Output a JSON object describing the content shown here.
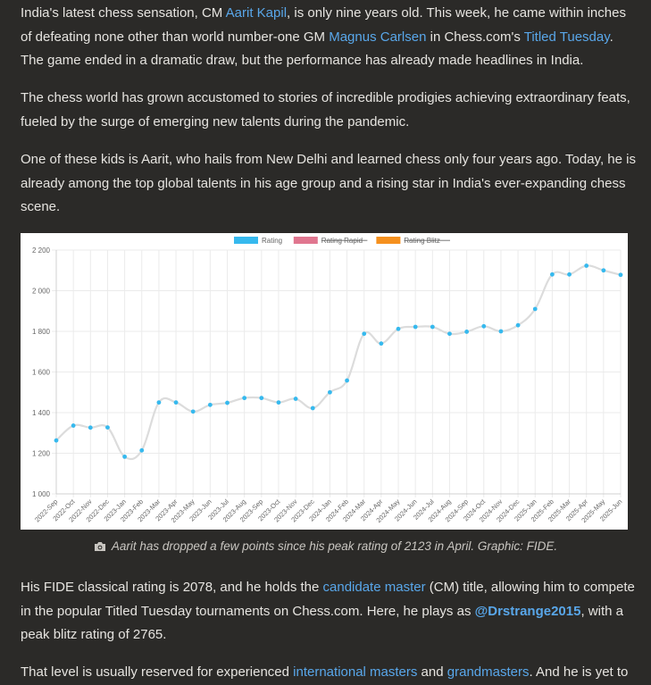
{
  "article": {
    "p1": {
      "t1": "India's latest chess sensation, CM ",
      "l1": "Aarit Kapil",
      "t2": ", is only nine years old. This week, he came within inches of defeating none other than world number-one GM ",
      "l2": "Magnus Carlsen",
      "t3": " in Chess.com's ",
      "l3": "Titled Tuesday",
      "t4": ". The game ended in a dramatic draw, but the performance has already made headlines in India."
    },
    "p2": "The chess world has grown accustomed to stories of incredible prodigies achieving extraordinary feats, fueled by the surge of emerging new talents during the pandemic.",
    "p3": "One of these kids is Aarit, who hails from New Delhi and learned chess only four years ago. Today, he is already among the top global talents in his age group and a rising star in India's ever-expanding chess scene.",
    "caption": "Aarit has dropped a few points since his peak rating of 2123 in April. Graphic: FIDE.",
    "p4": {
      "t1": "His FIDE classical rating is 2078, and he holds the ",
      "l1": "candidate master",
      "t2": " (CM) title, allowing him to compete in the popular Titled Tuesday tournaments on Chess.com. Here, he plays as ",
      "l2": "@Drstrange2015",
      "t3": ", with a peak blitz rating of 2765."
    },
    "p5": {
      "t1": "That level is usually reserved for experienced ",
      "l1": "international masters",
      "t2": " and ",
      "l2": "grandmasters",
      "t3": ". And he is yet to"
    }
  },
  "colors": {
    "background": "#2b2a28",
    "text": "#e6e4e0",
    "link": "#59a7ea",
    "line": "#dcdcdc",
    "point": "#36b9ee",
    "rapid": "#e0768f",
    "blitz": "#f5901e"
  },
  "icons": {
    "caption": "camera-icon"
  },
  "chart_data": {
    "type": "line",
    "legend": [
      {
        "name": "Rating",
        "color": "#36b9ee",
        "hidden": false
      },
      {
        "name": "Rating Rapid",
        "color": "#e0768f",
        "hidden": true
      },
      {
        "name": "Rating Blitz",
        "color": "#f5901e",
        "hidden": true
      }
    ],
    "legend_position": "top",
    "ylim": [
      1000,
      2200
    ],
    "yticks": [
      1000,
      1200,
      1400,
      1600,
      1800,
      2000,
      2200
    ],
    "ytick_labels": [
      "1 000",
      "1 200",
      "1 400",
      "1 600",
      "1 800",
      "2 000",
      "2 200"
    ],
    "grid": true,
    "categories": [
      "2022-Sep",
      "2022-Oct",
      "2022-Nov",
      "2022-Dec",
      "2023-Jan",
      "2023-Feb",
      "2023-Mar",
      "2023-Apr",
      "2023-May",
      "2023-Jun",
      "2023-Jul",
      "2023-Aug",
      "2023-Sep",
      "2023-Oct",
      "2023-Nov",
      "2023-Dec",
      "2024-Jan",
      "2024-Feb",
      "2024-Mar",
      "2024-Apr",
      "2024-May",
      "2024-Jun",
      "2024-Jul",
      "2024-Aug",
      "2024-Sep",
      "2024-Oct",
      "2024-Nov",
      "2024-Dec",
      "2025-Jan",
      "2025-Feb",
      "2025-Mar",
      "2025-Apr",
      "2025-May",
      "2025-Jun"
    ],
    "series": [
      {
        "name": "Rating",
        "values": [
          1263,
          1336,
          1326,
          1327,
          1183,
          1214,
          1450,
          1450,
          1405,
          1438,
          1448,
          1472,
          1472,
          1450,
          1468,
          1422,
          1500,
          1558,
          1788,
          1740,
          1812,
          1822,
          1822,
          1788,
          1798,
          1825,
          1800,
          1830,
          1910,
          2080,
          2080,
          2123,
          2100,
          2078
        ]
      }
    ]
  }
}
